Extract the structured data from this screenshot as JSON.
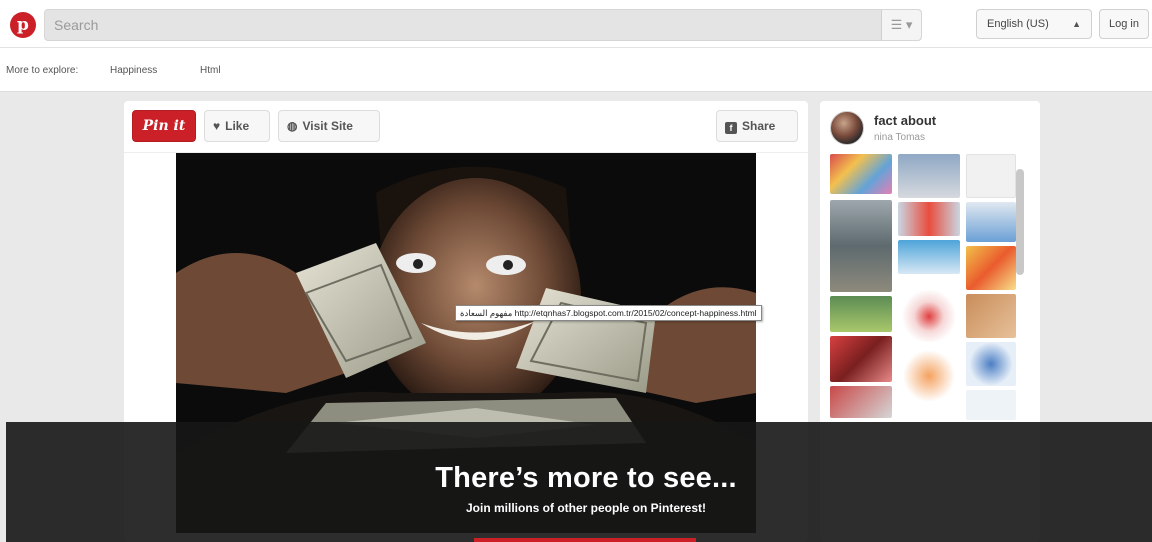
{
  "header": {
    "search_placeholder": "Search",
    "menu_icon": "list-menu-icon",
    "language": "English (US)",
    "login_label": "Log in"
  },
  "explore": {
    "label": "More to explore:",
    "links": [
      "Happiness",
      "Html"
    ]
  },
  "pin": {
    "pinit_label": "Pin it",
    "like_label": "Like",
    "visit_label": "Visit Site",
    "share_label": "Share",
    "tooltip_url": "http://etqnhas7.blogspot.com.tr/2015/02/concept-happiness.html",
    "tooltip_arabic": "مفهوم السعادة"
  },
  "board": {
    "title": "fact about",
    "owner": "nina Tomas"
  },
  "overlay": {
    "title": "There’s more to see...",
    "subtitle": "Join millions of other people on Pinterest!"
  },
  "colors": {
    "brand_red": "#cb2027",
    "overlay_bg": "#161616"
  }
}
